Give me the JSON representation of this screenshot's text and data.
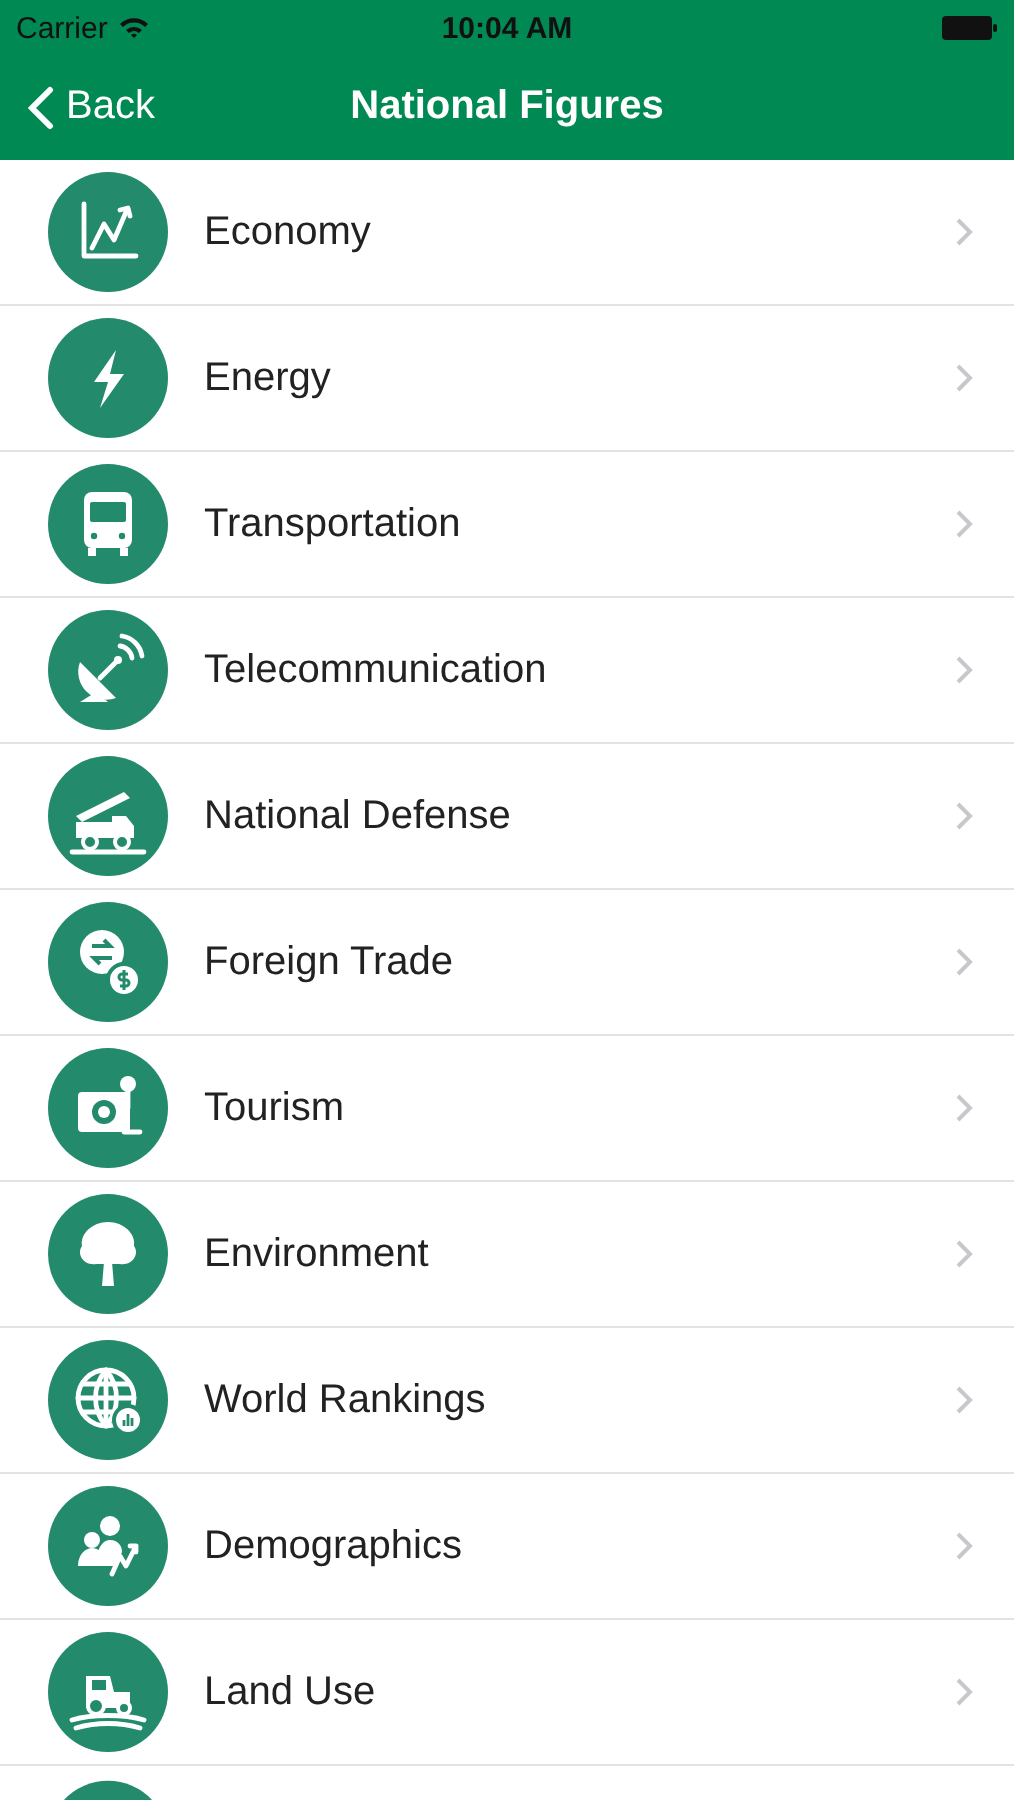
{
  "status_bar": {
    "carrier": "Carrier",
    "time": "10:04 AM"
  },
  "nav_bar": {
    "back": "Back",
    "title": "National Figures"
  },
  "items": [
    {
      "label": "Economy"
    },
    {
      "label": "Energy"
    },
    {
      "label": "Transportation"
    },
    {
      "label": "Telecommunication"
    },
    {
      "label": "National Defense"
    },
    {
      "label": "Foreign Trade"
    },
    {
      "label": "Tourism"
    },
    {
      "label": "Environment"
    },
    {
      "label": "World Rankings"
    },
    {
      "label": "Demographics"
    },
    {
      "label": "Land Use"
    }
  ]
}
